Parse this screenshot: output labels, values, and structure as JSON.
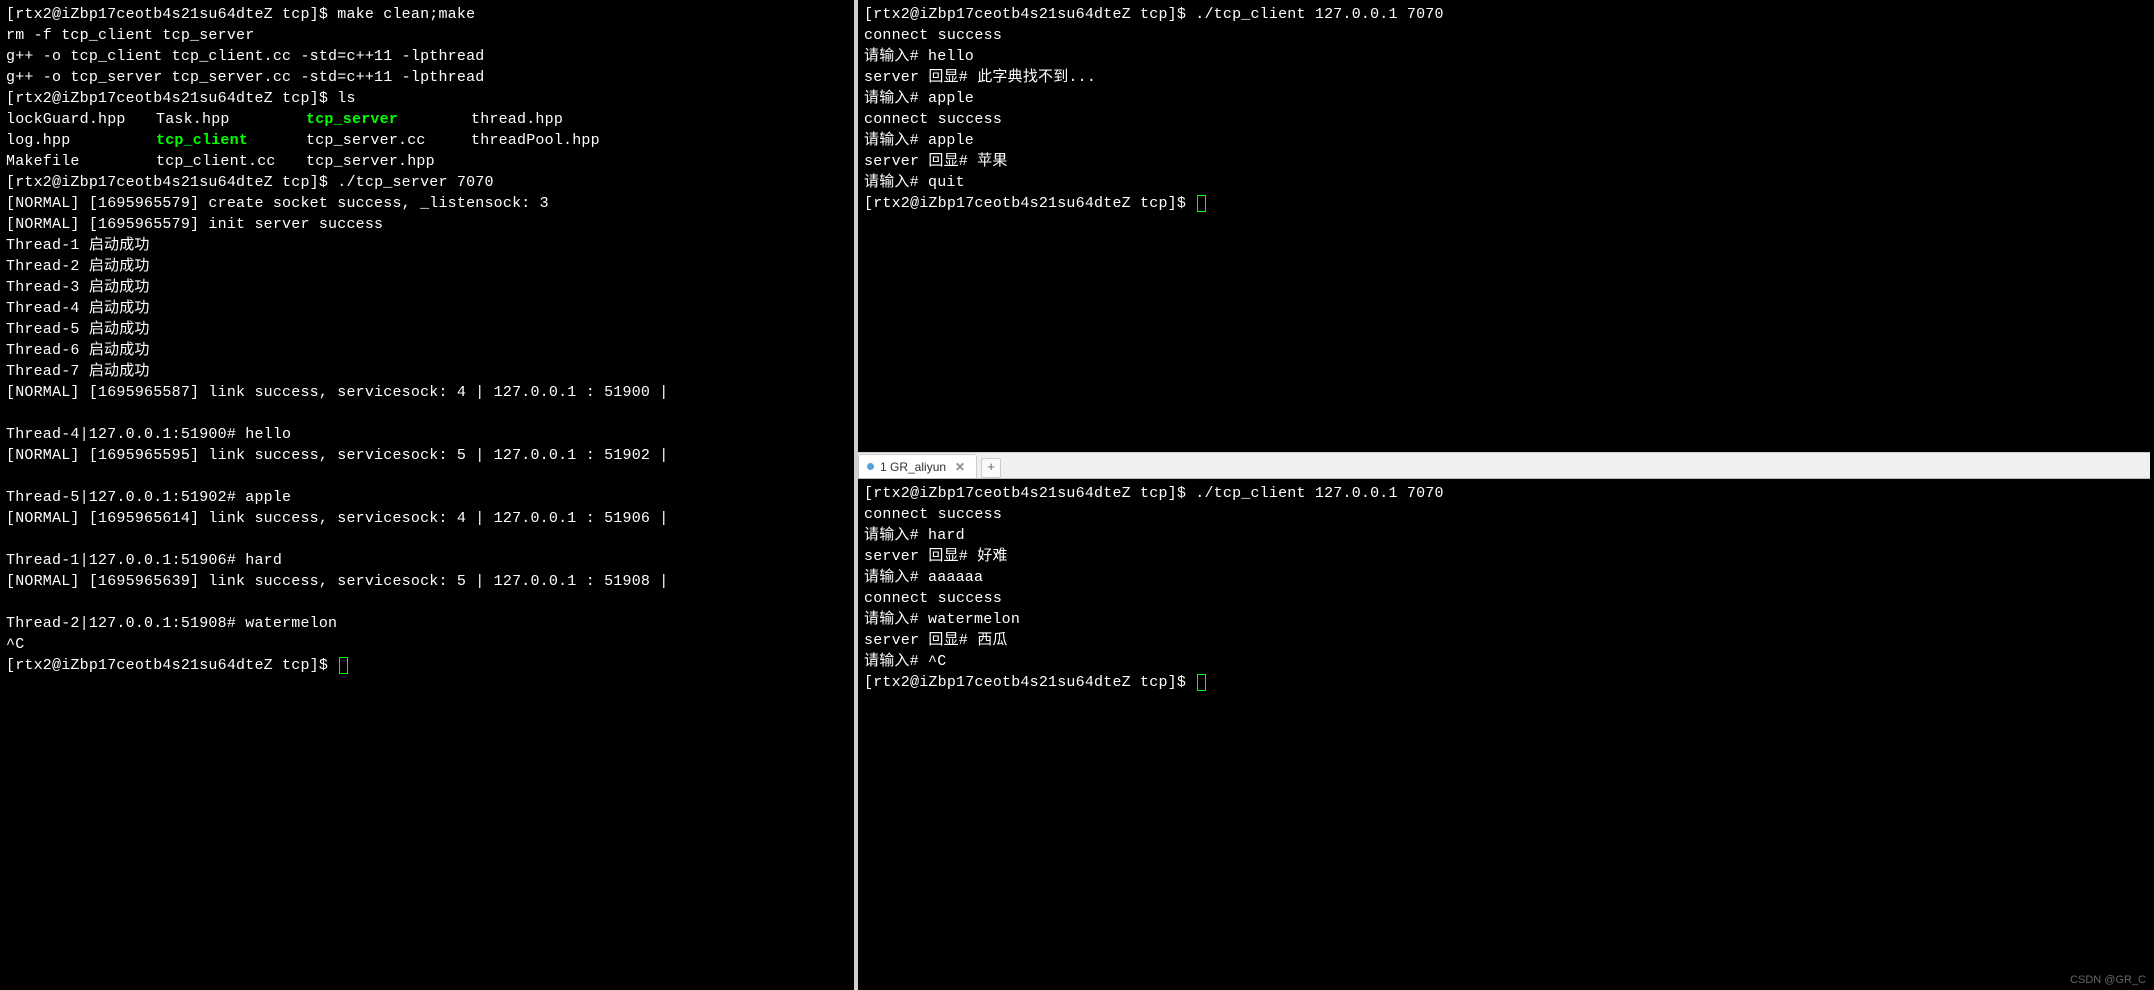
{
  "left_pane": {
    "prompt_prefix": "[rtx2@iZbp17ceotb4s21su64dteZ tcp]$ ",
    "cmd1": "make clean;make",
    "line2": "rm -f tcp_client tcp_server",
    "line3": "g++ -o tcp_client tcp_client.cc -std=c++11 -lpthread",
    "line4": "g++ -o tcp_server tcp_server.cc -std=c++11 -lpthread",
    "cmd2": "ls",
    "ls": {
      "row1": {
        "c1": "lockGuard.hpp",
        "c2": "Task.hpp",
        "c3_green": "tcp_server",
        "c4": "thread.hpp"
      },
      "row2": {
        "c1": "log.hpp",
        "c2_green": "tcp_client",
        "c3": "tcp_server.cc",
        "c4": "threadPool.hpp"
      },
      "row3": {
        "c1": "Makefile",
        "c2": "tcp_client.cc",
        "c3": "tcp_server.hpp",
        "c4": ""
      }
    },
    "cmd3": "./tcp_server 7070",
    "log1": "[NORMAL] [1695965579] create socket success, _listensock: 3",
    "log2": "[NORMAL] [1695965579] init server success",
    "thread1": "Thread-1 启动成功",
    "thread2": "Thread-2 启动成功",
    "thread3": "Thread-3 启动成功",
    "thread4": "Thread-4 启动成功",
    "thread5": "Thread-5 启动成功",
    "thread6": "Thread-6 启动成功",
    "thread7": "Thread-7 启动成功",
    "link1": "[NORMAL] [1695965587] link success, servicesock: 4 | 127.0.0.1 : 51900 |",
    "msg1": "Thread-4|127.0.0.1:51900# hello",
    "link2": "[NORMAL] [1695965595] link success, servicesock: 5 | 127.0.0.1 : 51902 |",
    "msg2": "Thread-5|127.0.0.1:51902# apple",
    "link3": "[NORMAL] [1695965614] link success, servicesock: 4 | 127.0.0.1 : 51906 |",
    "msg3": "Thread-1|127.0.0.1:51906# hard",
    "link4": "[NORMAL] [1695965639] link success, servicesock: 5 | 127.0.0.1 : 51908 |",
    "msg4": "Thread-2|127.0.0.1:51908# watermelon",
    "sigint": "^C"
  },
  "top_right": {
    "prompt_prefix": "[rtx2@iZbp17ceotb4s21su64dteZ tcp]$ ",
    "cmd": "./tcp_client 127.0.0.1 7070",
    "l1": "connect success",
    "l2": "请输入# hello",
    "l3": "server 回显# 此字典找不到...",
    "l4": "请输入# apple",
    "l5": "connect success",
    "l6": "请输入# apple",
    "l7": "server 回显# 苹果",
    "l8": "请输入# quit"
  },
  "tab": {
    "label": "1 GR_aliyun",
    "close": "✕",
    "add": "+"
  },
  "bottom_right": {
    "prompt_prefix": "[rtx2@iZbp17ceotb4s21su64dteZ tcp]$ ",
    "cmd": "./tcp_client 127.0.0.1 7070",
    "l1": "connect success",
    "l2": "请输入# hard",
    "l3": "server 回显# 好难",
    "l4": "请输入# aaaaaa",
    "l5": "connect success",
    "l6": "请输入# watermelon",
    "l7": "server 回显# 西瓜",
    "l8": "请输入# ^C"
  },
  "watermark": "CSDN @GR_C"
}
